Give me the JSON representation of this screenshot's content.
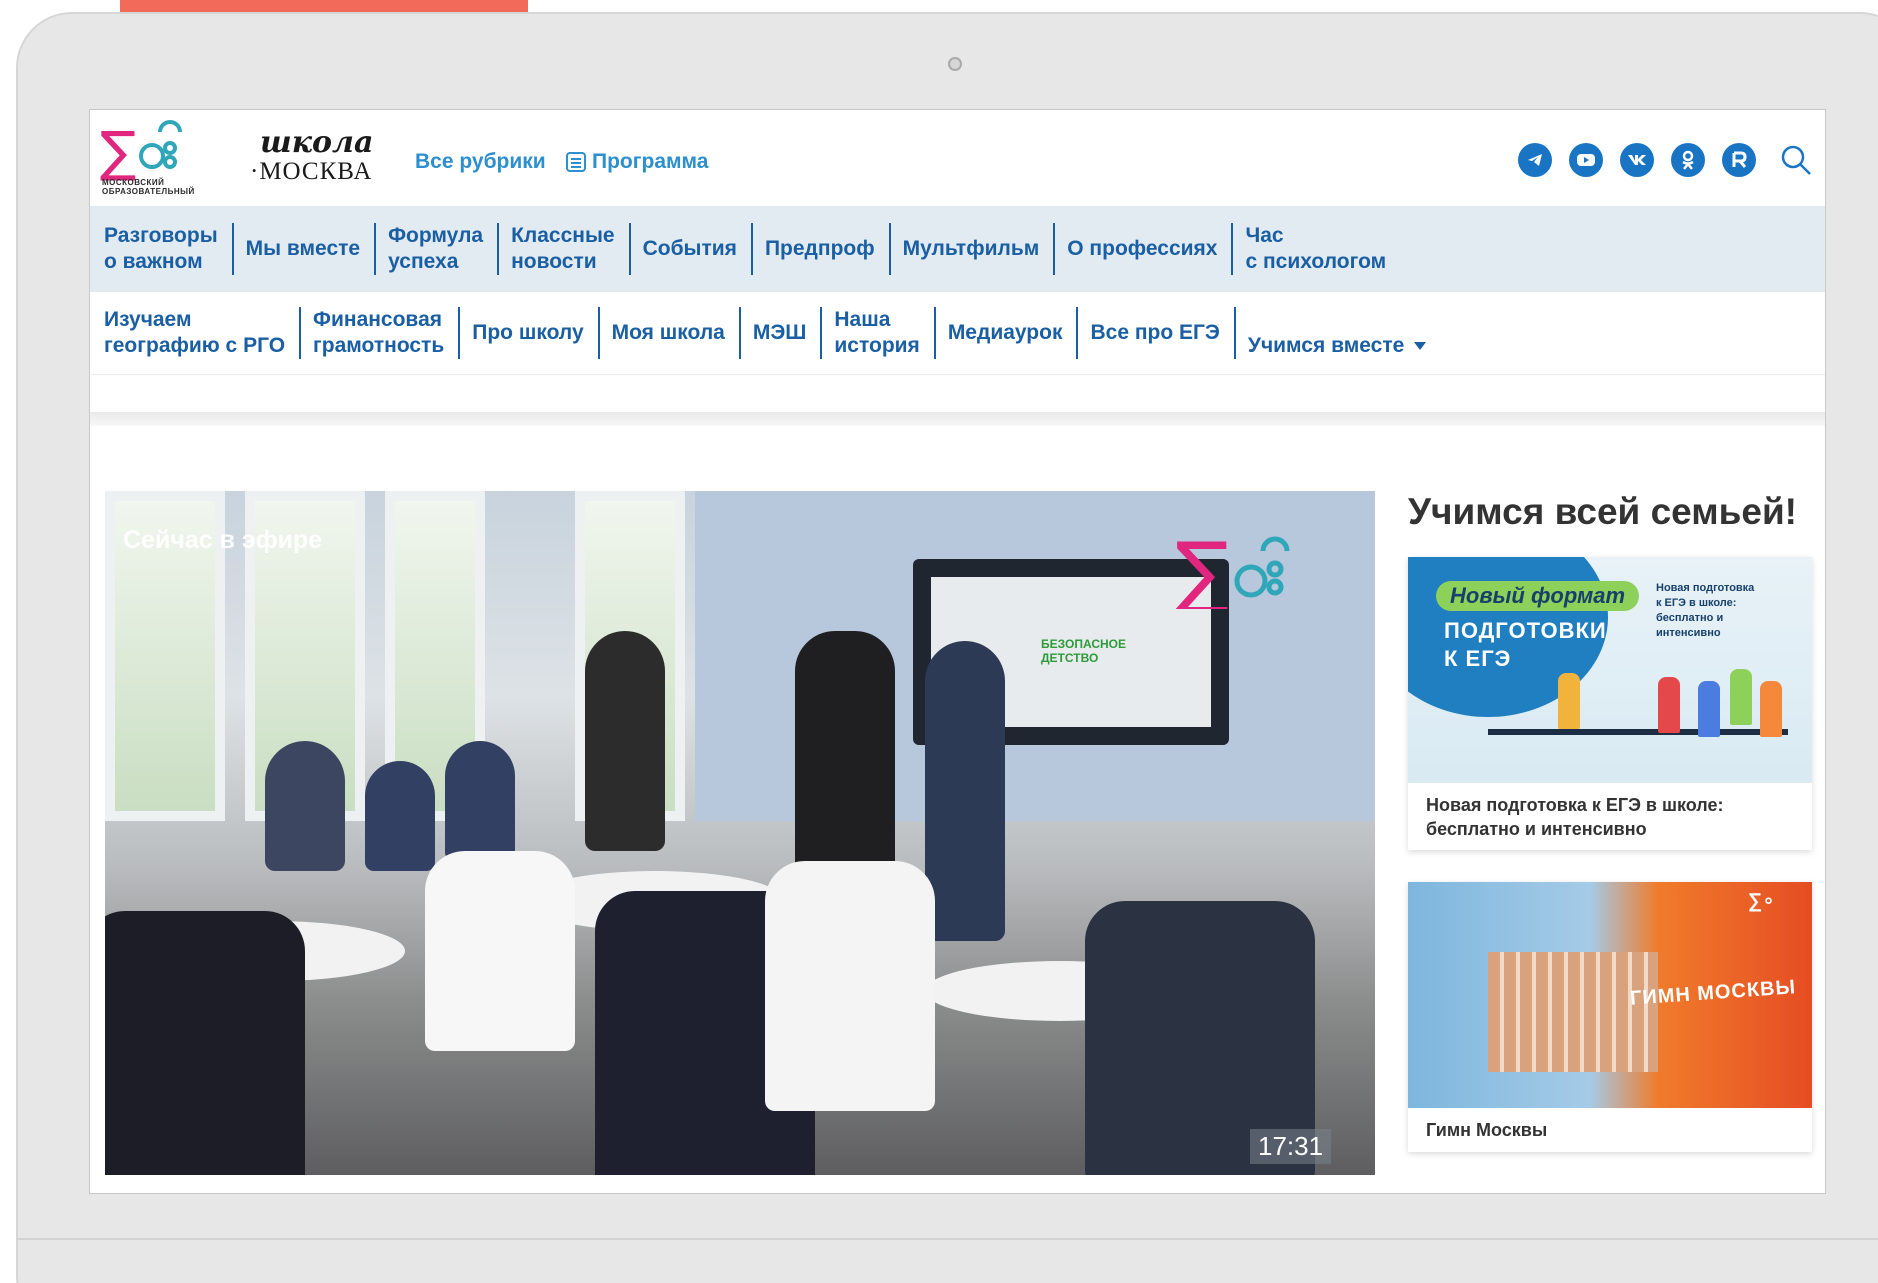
{
  "header": {
    "logo_caption": "Московский образовательный",
    "brand_school": "школа",
    "brand_city": "·МОСКВА",
    "links": {
      "rubrics": "Все рубрики",
      "program": "Программа"
    },
    "socials": [
      "telegram-icon",
      "youtube-icon",
      "vk-icon",
      "ok-icon",
      "rutube-icon"
    ]
  },
  "menu": {
    "row1": [
      "Разговоры\nо важном",
      "Мы вместе",
      "Формула\nуспеха",
      "Классные\nновости",
      "События",
      "Предпроф",
      "Мультфильм",
      "О профессиях",
      "Час\nс психологом"
    ],
    "row2": [
      "Изучаем\nгеографию с РГО",
      "Финансовая\nграмотность",
      "Про школу",
      "Моя школа",
      "МЭШ",
      "Наша\nистория",
      "Медиаурок",
      "Все про ЕГЭ",
      "Учимся вместе"
    ]
  },
  "live": {
    "label": "Сейчас в эфире",
    "time": "17:31",
    "board_text": "БЕЗОПАСНОЕ\nДЕТСТВО"
  },
  "side": {
    "title": "Учимся всей семьей!",
    "cards": [
      {
        "badge": "Новый формат",
        "big": "ПОДГОТОВКИ\nК ЕГЭ",
        "small": "Новая подготовка\nк ЕГЭ в школе:\nбесплатно и\nинтенсивно",
        "caption": "Новая подготовка к ЕГЭ в школе: бесплатно и интенсивно"
      },
      {
        "banner": "ГИМН МОСКВЫ",
        "caption": "Гимн Москвы"
      }
    ]
  },
  "colors": {
    "accent_strip": "#f26b5a",
    "link_blue": "#2c8fce",
    "menu_blue": "#1a5fa3",
    "menu_bg": "#e2eaf2",
    "social_blue": "#1a74c4"
  }
}
